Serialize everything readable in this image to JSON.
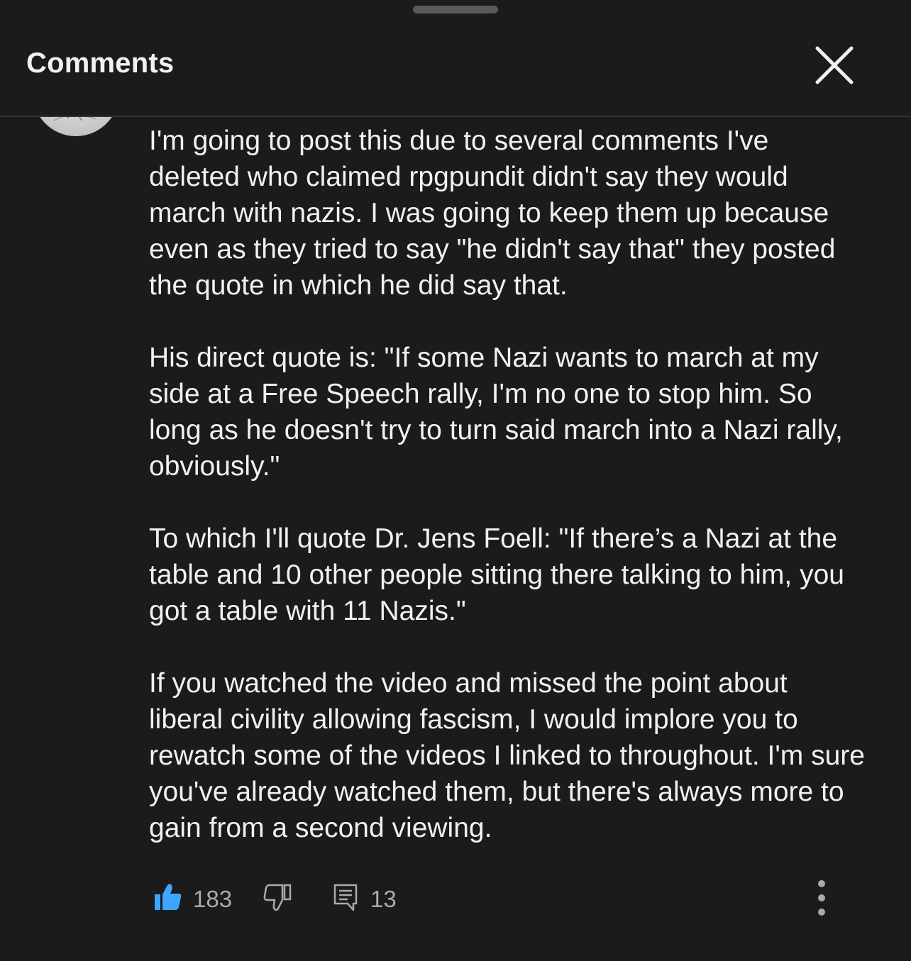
{
  "header": {
    "title": "Comments",
    "close_icon": "close-icon"
  },
  "comment": {
    "paragraphs": [
      "I'm going to post this due to several comments I've deleted who claimed rpgpundit didn't say they would march with nazis. I was going to keep them up because even as they tried to say \"he didn't say that\" they posted the quote in which he did say that.",
      "His direct quote is: \"If some Nazi wants to march at my side at a Free Speech rally, I'm no one to stop him. So long as he doesn't try to turn said march into a Nazi rally, obviously.\"",
      "To which I'll quote Dr. Jens Foell: \"If there’s a Nazi at the table and 10 other people sitting there talking to him, you got a table with 11 Nazis.\"",
      "If you watched the video and missed the point about liberal civility allowing fascism, I would implore you to rewatch some of the videos I linked to throughout. I'm sure you've already watched them, but there's always more to gain from a second viewing."
    ],
    "likes": "183",
    "replies": "13",
    "like_active_color": "#3ea6ff"
  }
}
